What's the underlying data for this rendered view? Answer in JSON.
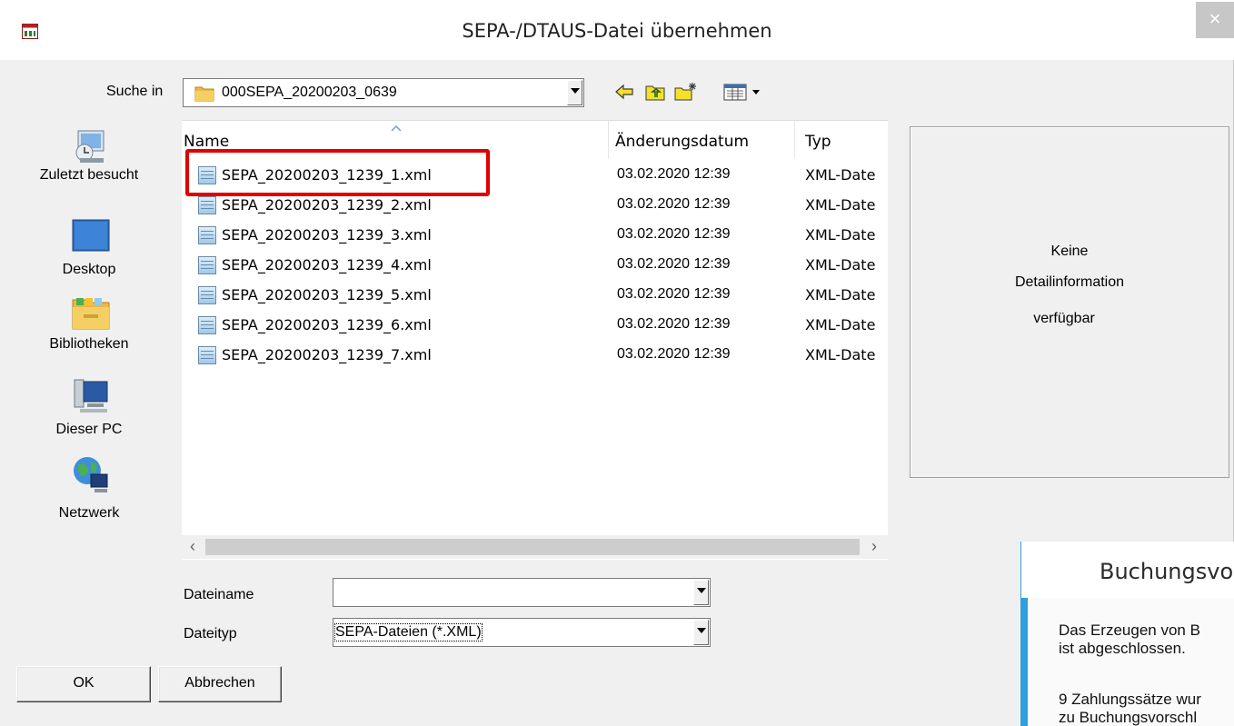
{
  "window": {
    "title": "SEPA-/DTAUS-Datei übernehmen",
    "close_symbol": "×"
  },
  "lookin": {
    "label": "Suche in",
    "value": "000SEPA_20200203_0639"
  },
  "toolbar": {
    "icons": [
      "back-arrow-icon",
      "up-folder-icon",
      "new-folder-icon",
      "view-menu-icon"
    ]
  },
  "places": [
    {
      "label": "Zuletzt besucht",
      "icon": "recent-places-icon"
    },
    {
      "label": "Desktop",
      "icon": "desktop-icon"
    },
    {
      "label": "Bibliotheken",
      "icon": "libraries-icon"
    },
    {
      "label": "Dieser PC",
      "icon": "computer-icon"
    },
    {
      "label": "Netzwerk",
      "icon": "network-icon"
    }
  ],
  "filelist": {
    "columns": {
      "name": "Name",
      "date": "Änderungsdatum",
      "type": "Typ"
    },
    "files": [
      {
        "name": "SEPA_20200203_1239_1.xml",
        "date": "03.02.2020 12:39",
        "type": "XML-Date"
      },
      {
        "name": "SEPA_20200203_1239_2.xml",
        "date": "03.02.2020 12:39",
        "type": "XML-Date"
      },
      {
        "name": "SEPA_20200203_1239_3.xml",
        "date": "03.02.2020 12:39",
        "type": "XML-Date"
      },
      {
        "name": "SEPA_20200203_1239_4.xml",
        "date": "03.02.2020 12:39",
        "type": "XML-Date"
      },
      {
        "name": "SEPA_20200203_1239_5.xml",
        "date": "03.02.2020 12:39",
        "type": "XML-Date"
      },
      {
        "name": "SEPA_20200203_1239_6.xml",
        "date": "03.02.2020 12:39",
        "type": "XML-Date"
      },
      {
        "name": "SEPA_20200203_1239_7.xml",
        "date": "03.02.2020 12:39",
        "type": "XML-Date"
      }
    ]
  },
  "details": {
    "line1": "Keine",
    "line2": "Detailinformation",
    "line3": "verfügbar"
  },
  "form": {
    "filename_label": "Dateiname",
    "filename_value": "",
    "filetype_label": "Dateityp",
    "filetype_value": "SEPA-Dateien (*.XML)"
  },
  "buttons": {
    "ok": "OK",
    "cancel": "Abbrechen"
  },
  "overlay": {
    "title": "Buchungsvo",
    "line1": "Das Erzeugen von B",
    "line2": "ist abgeschlossen.",
    "line3": "9 Zahlungssätze wur",
    "line4": "zu Buchungsvorschl"
  },
  "colors": {
    "highlight": "#e00000",
    "overlay_accent": "#2f9fdd"
  }
}
